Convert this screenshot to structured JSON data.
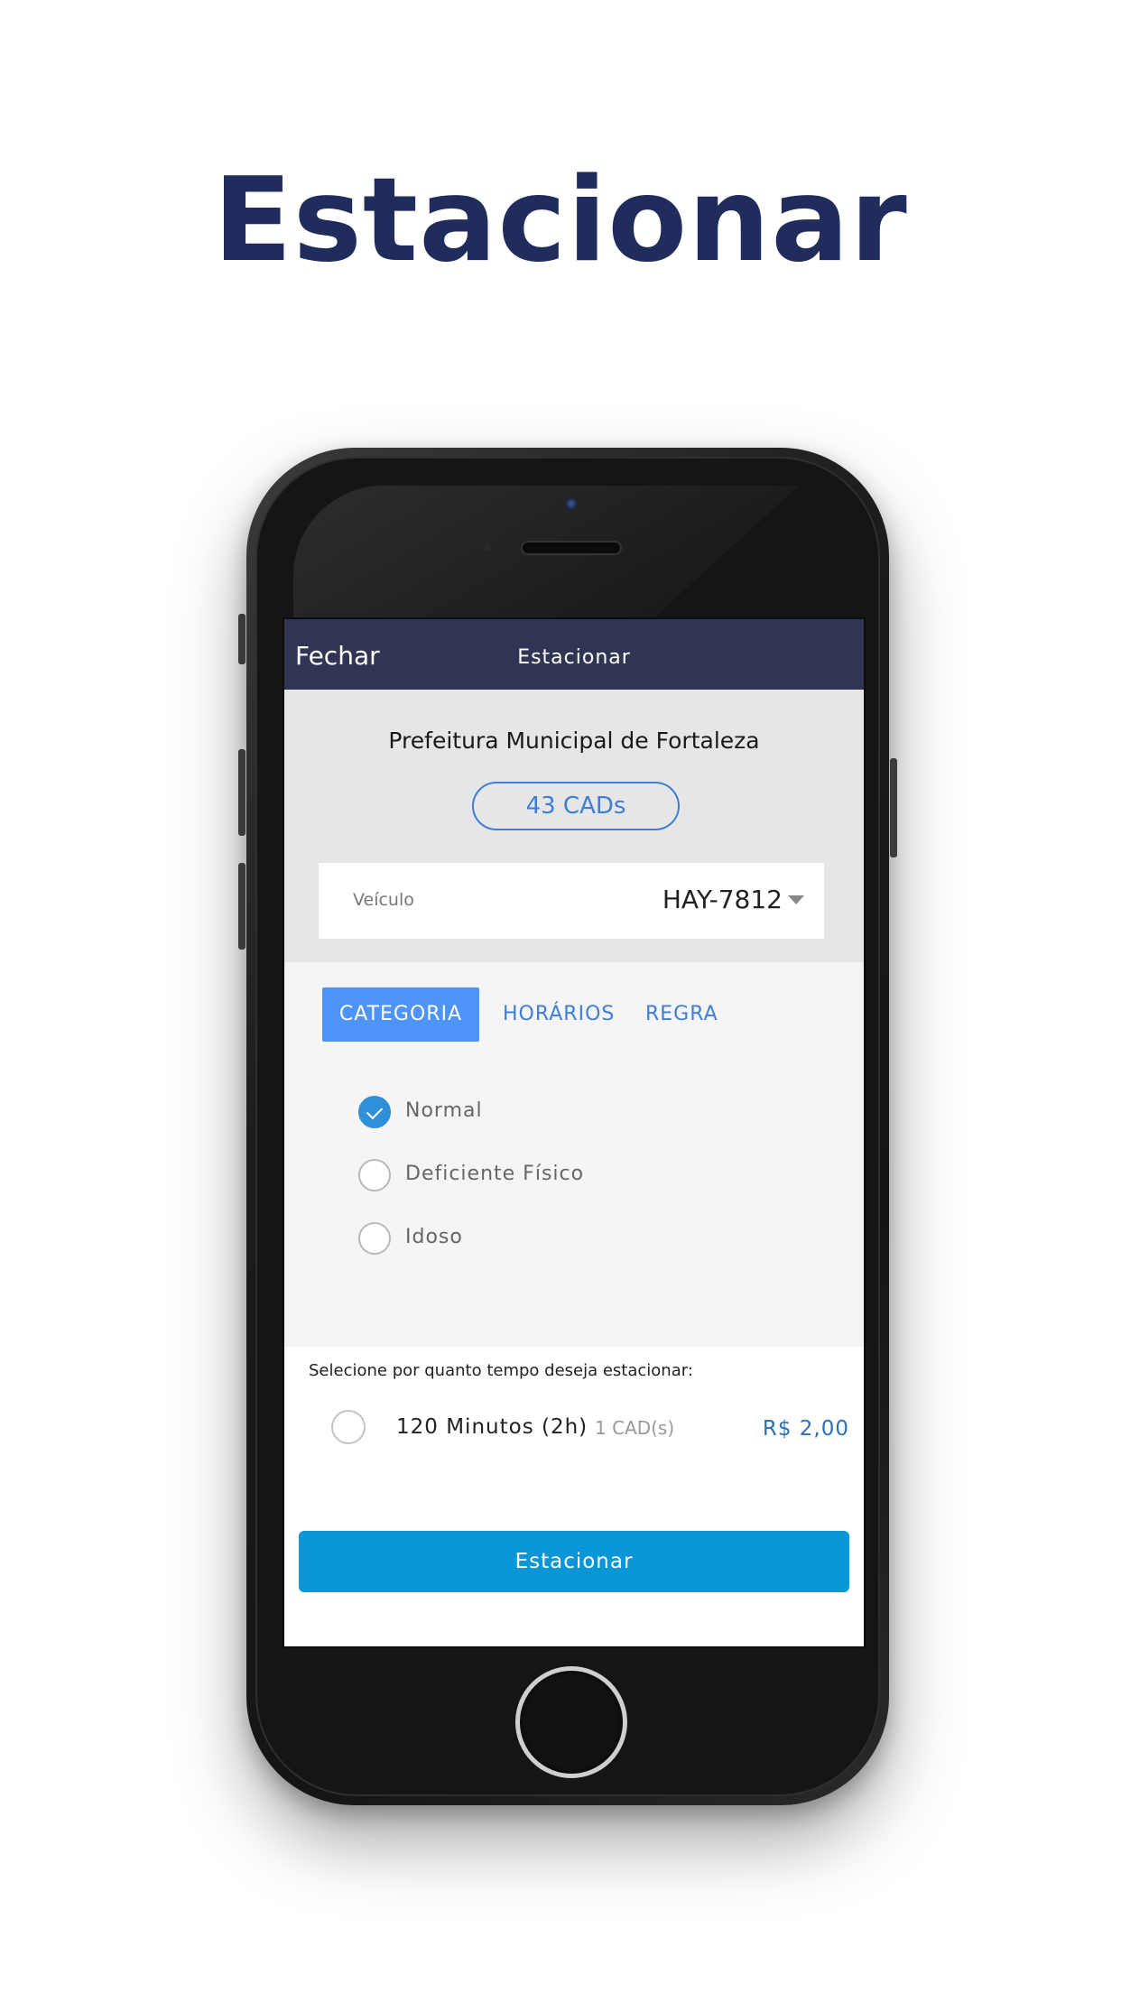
{
  "hero": {
    "title": "Estacionar"
  },
  "navbar": {
    "close_label": "Fechar",
    "title": "Estacionar"
  },
  "header": {
    "organization": "Prefeitura Municipal de Fortaleza",
    "cads_balance": "43 CADs"
  },
  "vehicle": {
    "label": "Veículo",
    "value": "HAY-7812"
  },
  "tabs": [
    {
      "label": "CATEGORIA",
      "active": true
    },
    {
      "label": "HORÁRIOS",
      "active": false
    },
    {
      "label": "REGRA",
      "active": false
    }
  ],
  "categories": [
    {
      "label": "Normal",
      "checked": true
    },
    {
      "label": "Deficiente Físico",
      "checked": false
    },
    {
      "label": "Idoso",
      "checked": false
    }
  ],
  "time_selection": {
    "prompt": "Selecione por quanto tempo deseja estacionar:",
    "options": [
      {
        "label": "120 Minutos (2h)",
        "cads": "1 CAD(s)",
        "price": "R$ 2,00",
        "checked": false
      }
    ]
  },
  "submit": {
    "label": "Estacionar"
  },
  "colors": {
    "hero_title": "#1f2c5c",
    "navbar": "#2f3553",
    "accent_blue": "#3d7ed9",
    "active_tab": "#4e93f7",
    "button": "#0996d7",
    "price": "#2f6fb5"
  },
  "icons": {
    "checked_radio": "check-icon",
    "dropdown": "caret-down-icon"
  }
}
